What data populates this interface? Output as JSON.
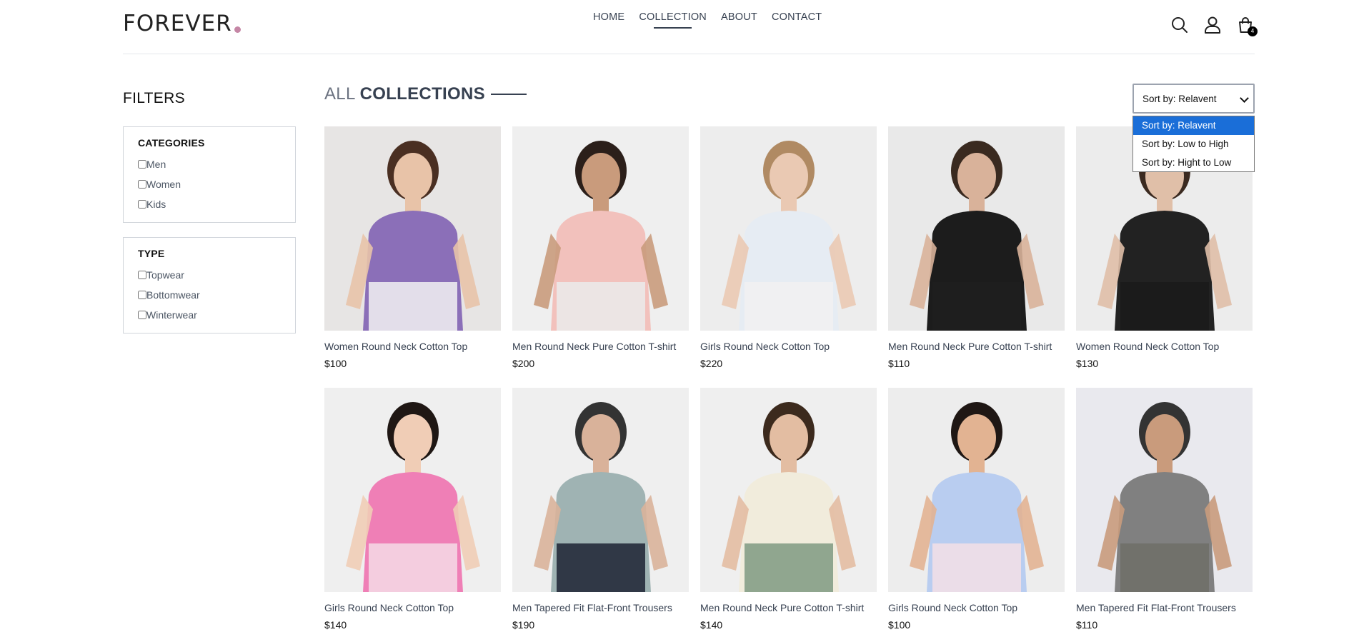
{
  "brand": {
    "name": "FOREVER",
    "dot_color": "#c586a5"
  },
  "nav": {
    "items": [
      {
        "label": "HOME"
      },
      {
        "label": "COLLECTION"
      },
      {
        "label": "ABOUT"
      },
      {
        "label": "CONTACT"
      }
    ]
  },
  "header": {
    "cart_count": "4",
    "icons": [
      "search-icon",
      "profile-icon",
      "cart-icon"
    ]
  },
  "filters": {
    "title": "FILTERS",
    "categories": {
      "heading": "CATEGORIES",
      "options": [
        "Men",
        "Women",
        "Kids"
      ]
    },
    "type": {
      "heading": "TYPE",
      "options": [
        "Topwear",
        "Bottomwear",
        "Winterwear"
      ]
    }
  },
  "collection": {
    "title_a": "ALL",
    "title_b": "COLLECTIONS"
  },
  "sort": {
    "selected": "Sort by: Relavent",
    "options": [
      "Sort by: Relavent",
      "Sort by: Low to High",
      "Sort by: Hight to Low"
    ],
    "highlight_color": "#1a6ed8"
  },
  "products": [
    {
      "name": "Women Round Neck Cotton Top",
      "price": "$100",
      "bg": "#e7e5e4",
      "top": "#8b6fb8",
      "bottom": "#f2f2f2",
      "skin": "#e8c3a8",
      "hair": "#4a2f22"
    },
    {
      "name": "Men Round Neck Pure Cotton T-shirt",
      "price": "$200",
      "bg": "#efefef",
      "top": "#f2c1bc",
      "bottom": "#ebebeb",
      "skin": "#c99b7c",
      "hair": "#2b1f1a"
    },
    {
      "name": "Girls Round Neck Cotton Top",
      "price": "$220",
      "bg": "#ededed",
      "top": "#e6ecf3",
      "bottom": "#f1f1f1",
      "skin": "#eac9b3",
      "hair": "#b08a63"
    },
    {
      "name": "Men Round Neck Pure Cotton T-shirt",
      "price": "$110",
      "bg": "#e9e9e9",
      "top": "#1c1c1c",
      "bottom": "#1f1f1f",
      "skin": "#d9b29a",
      "hair": "#3a2a20"
    },
    {
      "name": "Women Round Neck Cotton Top",
      "price": "$130",
      "bg": "#ececec",
      "top": "#222222",
      "bottom": "#1a1a1a",
      "skin": "#e0bfa8",
      "hair": "#3b2a20"
    },
    {
      "name": "Girls Round Neck Cotton Top",
      "price": "$140",
      "bg": "#efefef",
      "top": "#ef7fb6",
      "bottom": "#f5dbe6",
      "skin": "#f0cdb6",
      "hair": "#1f1714"
    },
    {
      "name": "Men Tapered Fit Flat-Front Trousers",
      "price": "$190",
      "bg": "#efefef",
      "top": "#9fb3b3",
      "bottom": "#1c2233",
      "skin": "#d9b29a",
      "hair": "#333333"
    },
    {
      "name": "Men Round Neck Pure Cotton T-shirt",
      "price": "$140",
      "bg": "#efefef",
      "top": "#f1ecdc",
      "bottom": "#7f9a81",
      "skin": "#e3bda2",
      "hair": "#3c2a1d"
    },
    {
      "name": "Girls Round Neck Cotton Top",
      "price": "$100",
      "bg": "#ededed",
      "top": "#b9cdf0",
      "bottom": "#f3dfe6",
      "skin": "#e2b392",
      "hair": "#1f1714"
    },
    {
      "name": "Men Tapered Fit Flat-Front Trousers",
      "price": "$110",
      "bg": "#e9e9ee",
      "top": "#808080",
      "bottom": "#6e6f67",
      "skin": "#c99b7c",
      "hair": "#333333"
    }
  ]
}
